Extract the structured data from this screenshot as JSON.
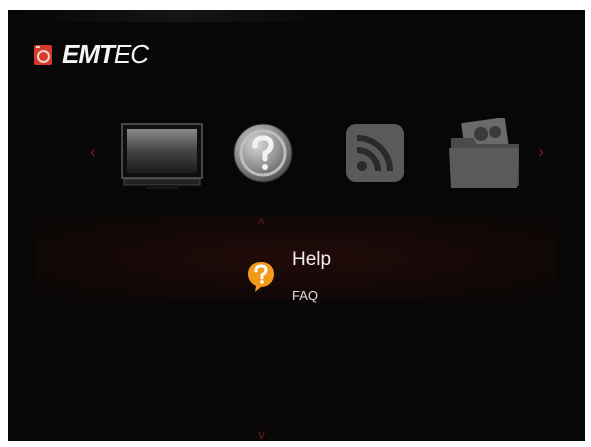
{
  "brand": {
    "name_bold": "EMT",
    "name_light": "EC"
  },
  "menu": {
    "items": [
      {
        "icon": "tv-icon"
      },
      {
        "icon": "help-icon"
      },
      {
        "icon": "rss-icon"
      },
      {
        "icon": "folder-icon"
      }
    ],
    "selected_index": 1
  },
  "selected": {
    "title": "Help",
    "subtitle": "FAQ"
  },
  "nav": {
    "left": "‹",
    "right": "›",
    "up": "^",
    "down": "v"
  },
  "colors": {
    "background": "#080606",
    "accent": "#d43a2a",
    "help_orange": "#f39a1a"
  }
}
